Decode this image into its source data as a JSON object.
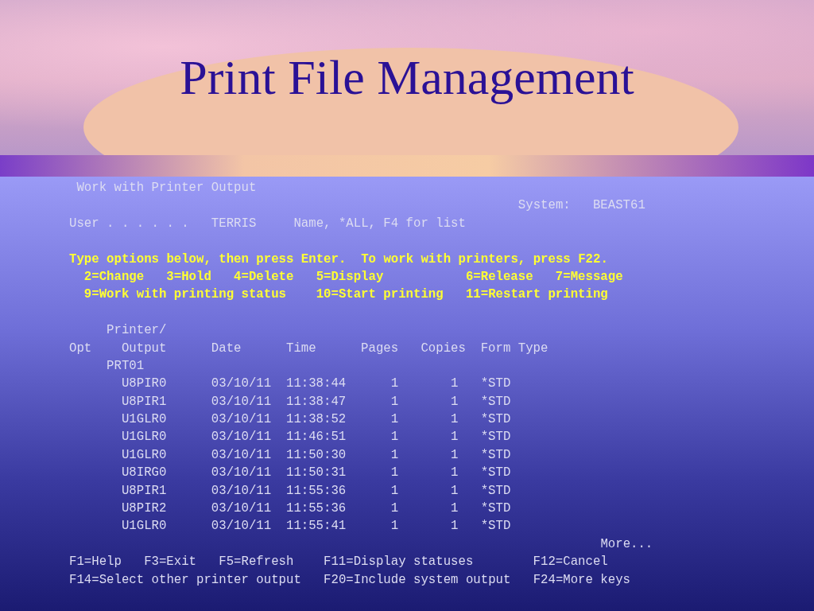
{
  "slide_title": "Print File Management",
  "screen": {
    "title": "Work with Printer Output",
    "system_label": "System:",
    "system_name": "BEAST61",
    "user_label": "User . . . . . .",
    "user_value": "TERRIS",
    "user_hint": "Name, *ALL, F4 for list",
    "instructions": "Type options below, then press Enter.  To work with printers, press F22.",
    "options": [
      [
        "2=Change",
        "3=Hold",
        "4=Delete",
        "5=Display",
        "6=Release",
        "7=Message"
      ],
      [
        "9=Work with printing status",
        "10=Start printing",
        "11=Restart printing"
      ]
    ],
    "column_top": "Printer/",
    "columns": [
      "Opt",
      "Output",
      "Date",
      "Time",
      "Pages",
      "Copies",
      "Form Type"
    ],
    "printer": "PRT01",
    "rows": [
      {
        "output": "U8PIR0",
        "date": "03/10/11",
        "time": "11:38:44",
        "pages": "1",
        "copies": "1",
        "form_type": "*STD"
      },
      {
        "output": "U8PIR1",
        "date": "03/10/11",
        "time": "11:38:47",
        "pages": "1",
        "copies": "1",
        "form_type": "*STD"
      },
      {
        "output": "U1GLR0",
        "date": "03/10/11",
        "time": "11:38:52",
        "pages": "1",
        "copies": "1",
        "form_type": "*STD"
      },
      {
        "output": "U1GLR0",
        "date": "03/10/11",
        "time": "11:46:51",
        "pages": "1",
        "copies": "1",
        "form_type": "*STD"
      },
      {
        "output": "U1GLR0",
        "date": "03/10/11",
        "time": "11:50:30",
        "pages": "1",
        "copies": "1",
        "form_type": "*STD"
      },
      {
        "output": "U8IRG0",
        "date": "03/10/11",
        "time": "11:50:31",
        "pages": "1",
        "copies": "1",
        "form_type": "*STD"
      },
      {
        "output": "U8PIR1",
        "date": "03/10/11",
        "time": "11:55:36",
        "pages": "1",
        "copies": "1",
        "form_type": "*STD"
      },
      {
        "output": "U8PIR2",
        "date": "03/10/11",
        "time": "11:55:36",
        "pages": "1",
        "copies": "1",
        "form_type": "*STD"
      },
      {
        "output": "U1GLR0",
        "date": "03/10/11",
        "time": "11:55:41",
        "pages": "1",
        "copies": "1",
        "form_type": "*STD"
      }
    ],
    "more": "More...",
    "function_keys": [
      [
        "F1=Help",
        "F3=Exit",
        "F5=Refresh",
        "F11=Display statuses",
        "F12=Cancel"
      ],
      [
        "F14=Select other printer output",
        "F20=Include system output",
        "F24=More keys"
      ]
    ]
  }
}
